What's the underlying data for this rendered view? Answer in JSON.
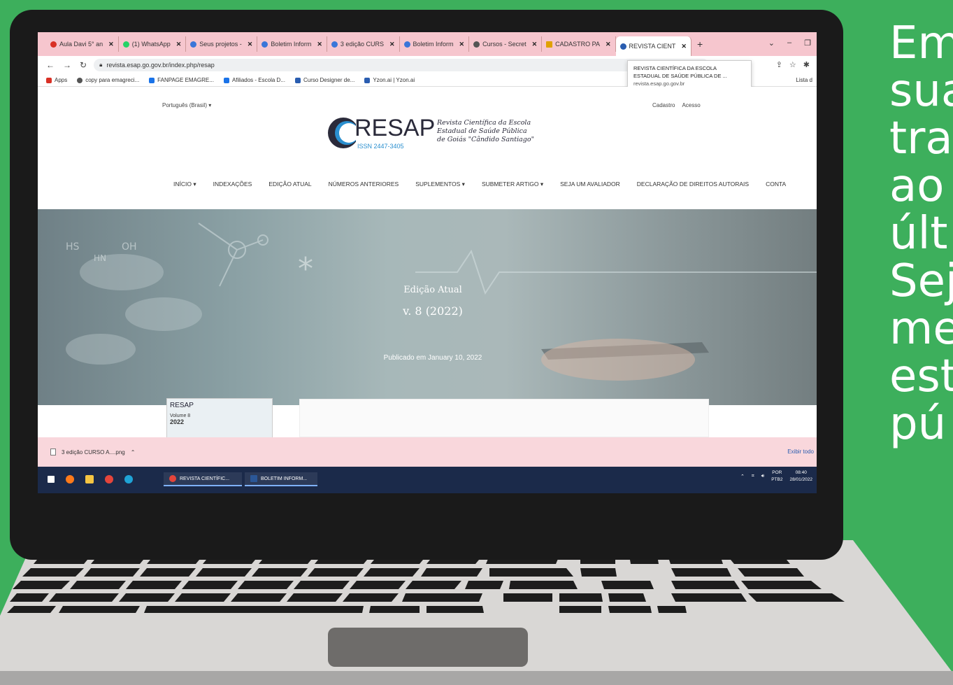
{
  "side_text": {
    "lines": [
      "Em",
      "sua",
      "tra",
      "ao",
      "últ",
      "Sej",
      "me",
      "est",
      "pú"
    ]
  },
  "browser": {
    "tabs": [
      {
        "label": "Aula Davi 5° an",
        "color": "#d93025"
      },
      {
        "label": "(1) WhatsApp",
        "color": "#25d366"
      },
      {
        "label": "Seus projetos -",
        "color": "#3b76d9"
      },
      {
        "label": "Boletim Inform",
        "color": "#3b76d9"
      },
      {
        "label": "3 edição CURS",
        "color": "#3b76d9"
      },
      {
        "label": "Boletim Inform",
        "color": "#3b76d9"
      },
      {
        "label": "Cursos - Secret",
        "color": "#555555"
      },
      {
        "label": "CADASTRO PA",
        "color": "#e0a100"
      },
      {
        "label": "REVISTA CIENT",
        "color": "#2a5db0",
        "active": true
      }
    ],
    "new_tab": "+",
    "address": "revista.esap.go.gov.br/index.php/resap",
    "bookmarks": [
      {
        "label": "Apps",
        "color": "#d93025"
      },
      {
        "label": "copy para emagreci...",
        "color": "#555555"
      },
      {
        "label": "FANPAGE EMAGRE...",
        "color": "#1a73e8"
      },
      {
        "label": "Afiliados - Escola D...",
        "color": "#1a73e8"
      },
      {
        "label": "Curso Designer de...",
        "color": "#2a5db0"
      },
      {
        "label": "Yzon.ai | Yzon.ai",
        "color": "#2a5db0"
      }
    ],
    "bookmarks_right": "Lista d",
    "tooltip": {
      "line1": "REVISTA CIENTÍFICA DA ESCOLA",
      "line2": "ESTADUAL DE SAÚDE PÚBLICA DE ...",
      "url": "revista.esap.go.gov.br"
    }
  },
  "site": {
    "language": "Português (Brasil)",
    "register": "Cadastro",
    "login": "Acesso",
    "logo_text": "RESAP",
    "issn": "ISSN 2447-3405",
    "logo_desc_1": "Revista Científica da Escola",
    "logo_desc_2": "Estadual de Saúde Pública",
    "logo_desc_3": "de Goiás \"Cândido Santiago\"",
    "menu": [
      "INÍCIO ▾",
      "INDEXAÇÕES",
      "EDIÇÃO ATUAL",
      "NÚMEROS ANTERIORES",
      "SUPLEMENTOS ▾",
      "SUBMETER ARTIGO ▾",
      "SEJA UM AVALIADOR",
      "DECLARAÇÃO DE DIREITOS AUTORAIS",
      "CONTA"
    ],
    "hero_title": "Edição Atual",
    "hero_volume": "v. 8 (2022)",
    "hero_published": "Publicado em January 10, 2022",
    "cover_logo": "RESAP",
    "cover_volume": "Volume 8",
    "cover_year": "2022"
  },
  "download": {
    "file": "3 edição CURSO A....png",
    "show_all": "Exibir todo"
  },
  "taskbar": {
    "apps": [
      {
        "label": "REVISTA CIENTÍFIC..."
      },
      {
        "label": "BOLETIM INFORM..."
      }
    ],
    "lang_1": "POR",
    "lang_2": "PTB2",
    "time": "08:40",
    "date": "28/01/2022"
  }
}
